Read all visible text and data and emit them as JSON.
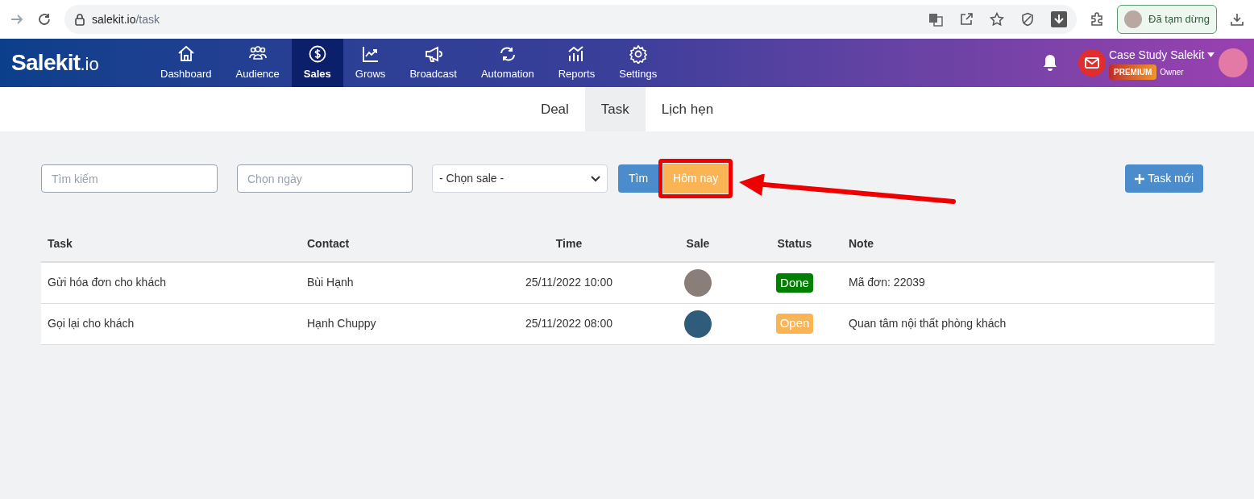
{
  "browser": {
    "url_host": "salekit.io",
    "url_path": "/task",
    "profile_label": "Đã tạm dừng"
  },
  "header": {
    "logo_main": "Salekit",
    "logo_suffix": ".io",
    "nav": [
      {
        "label": "Dashboard",
        "selected": false
      },
      {
        "label": "Audience",
        "selected": false
      },
      {
        "label": "Sales",
        "selected": true
      },
      {
        "label": "Grows",
        "selected": false
      },
      {
        "label": "Broadcast",
        "selected": false
      },
      {
        "label": "Automation",
        "selected": false
      },
      {
        "label": "Reports",
        "selected": false
      },
      {
        "label": "Settings",
        "selected": false
      }
    ],
    "account": {
      "name": "Case Study Salekit",
      "plan": "PREMIUM",
      "role": "Owner"
    }
  },
  "tabs": [
    {
      "label": "Deal",
      "selected": false
    },
    {
      "label": "Task",
      "selected": true
    },
    {
      "label": "Lịch hẹn",
      "selected": false
    }
  ],
  "filters": {
    "search_placeholder": "Tìm kiếm",
    "date_placeholder": "Chọn ngày",
    "sale_select": "- Chọn sale -",
    "search_button": "Tìm",
    "today_button": "Hôm nay",
    "new_button": "Task mới"
  },
  "table": {
    "columns": [
      "Task",
      "Contact",
      "Time",
      "Sale",
      "Status",
      "Note"
    ],
    "rows": [
      {
        "task": "Gửi hóa đơn cho khách",
        "contact": "Bùi Hạnh",
        "time": "25/11/2022 10:00",
        "status": "Done",
        "color": "#008000",
        "note": "Mã đơn: 22039"
      },
      {
        "task": "Gọi lại cho khách",
        "contact": "Hạnh Chuppy",
        "time": "25/11/2022 08:00",
        "status": "Open",
        "color": "#fbb454",
        "note": "Quan tâm nội thất phòng khách"
      }
    ]
  }
}
